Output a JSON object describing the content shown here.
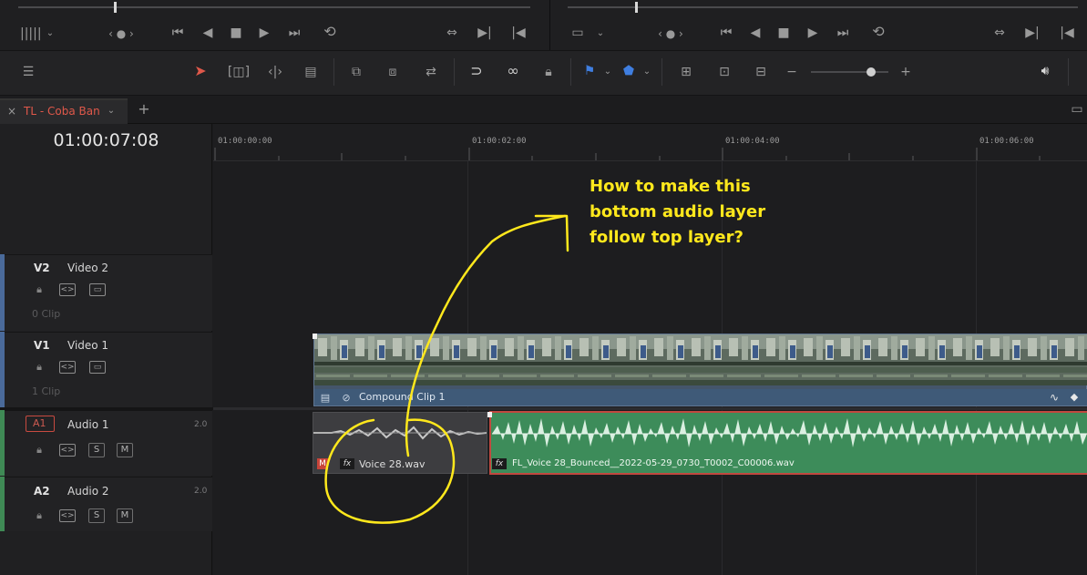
{
  "timeline": {
    "tab_label": "TL - Coba Ban",
    "timecode": "01:00:07:08",
    "ruler": [
      "01:00:00:00",
      "01:00:02:00",
      "01:00:04:00",
      "01:00:06:00"
    ]
  },
  "tracks": {
    "v2": {
      "id": "V2",
      "name": "Video 2",
      "clips": "0 Clip"
    },
    "v1": {
      "id": "V1",
      "name": "Video 1",
      "clips": "1 Clip"
    },
    "a1": {
      "id": "A1",
      "name": "Audio 1",
      "channels": "2.0",
      "solo": "S",
      "mute": "M"
    },
    "a2": {
      "id": "A2",
      "name": "Audio 2",
      "channels": "2.0",
      "solo": "S",
      "mute": "M"
    }
  },
  "clips": {
    "video": "Compound Clip 1",
    "audio_original": "Voice 28.wav",
    "audio_bounced": "FL_Voice 28_Bounced__2022-05-29_0730_T0002_C00006.wav",
    "fx_badge": "fx",
    "mute_badge": "M"
  },
  "annotation": {
    "line1": "How to make this",
    "line2": "bottom audio layer",
    "line3": "follow top layer?",
    "color": "#ffe81c"
  },
  "colors": {
    "accent_red": "#e0584a",
    "video_clip": "#44556a",
    "audio_clip": "#3d8c5a",
    "video_track": "#4a6a9a",
    "audio_track": "#3f8a55"
  },
  "icons": [
    "waveform-icon",
    "dropdown-icon",
    "prev-edit-icon",
    "skip-back-icon",
    "play-reverse-icon",
    "stop-icon",
    "play-icon",
    "skip-forward-icon",
    "loop-icon",
    "selection-icon",
    "trim-icon",
    "blade-icon",
    "snapping-icon",
    "link-icon",
    "lock-icon",
    "flag-icon",
    "marker-icon",
    "zoom-icon",
    "speaker-icon"
  ]
}
